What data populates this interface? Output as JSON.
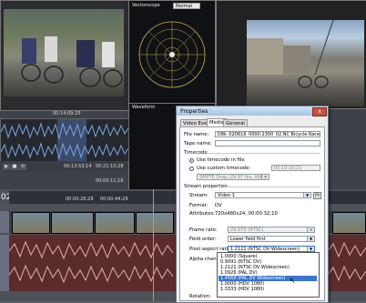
{
  "scopes": {
    "vectorscope_title": "Vectorscope",
    "mode_value": "Normal",
    "waveform_title": "Waveform"
  },
  "trimmer": {
    "tc_start": "00:14:09:25",
    "tc_in": "00:13:53;14",
    "tc_out": "00:21:10;28",
    "tc_length": "00:00:11;16",
    "track_number": "02"
  },
  "timeline": {
    "ruler_ticks": [
      "00:00:29:29",
      "00:00:44:29"
    ]
  },
  "dialog": {
    "title": "Properties",
    "close_label": "x",
    "tabs": [
      "Video Event",
      "Media",
      "General"
    ],
    "active_tab": "Media",
    "file_name_label": "File name:",
    "file_name_value": "D8k_020616_0000-2300_02.NC Bicycle Race (Jwxeh).a...",
    "tape_name_label": "Tape name:",
    "tape_name_value": "",
    "timecode_label": "Timecode",
    "use_timecode_label": "Use timecode in file",
    "use_custom_label": "Use custom timecode:",
    "custom_timecode_value": "00:10:10;21",
    "custom_timecode_format": "SMPTE Drop (29.97 fps, Video)",
    "stream_props_label": "Stream properties",
    "stream_label": "Stream:",
    "stream_value": "Video 1",
    "format_label": "Format:",
    "format_value": "DV",
    "attributes_label": "Attributes:",
    "attributes_value": "720x480x24, 00:00:32;10",
    "frame_rate_label": "Frame rate:",
    "frame_rate_value": "29.970 (NTSC)",
    "field_order_label": "Field order:",
    "field_order_value": "Lower field first",
    "par_label": "Pixel aspect ratio:",
    "par_value": "1.2121 (NTSC DV Widescreen)",
    "alpha_label": "Alpha channel:",
    "rotation_label": "Rotation:",
    "par_options": [
      "1.0000 (Square)",
      "0.9091 (NTSC DV)",
      "1.2121 (NTSC DV Widescreen)",
      "1.0926 (PAL DV)",
      "1.4568 (PAL DV Widescreen)",
      "1.0000 (HDV 1080)",
      "1.3333 (HDV 1080)"
    ],
    "par_selected_index": 4
  },
  "colors": {
    "accent": "#3b74c9",
    "playhead": "#ff8c00"
  }
}
